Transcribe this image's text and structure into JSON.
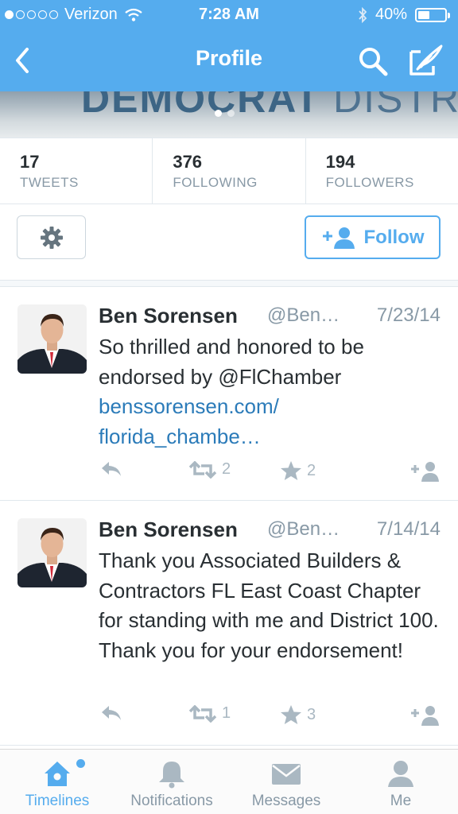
{
  "status_bar": {
    "carrier": "Verizon",
    "time": "7:28 AM",
    "battery": "40%"
  },
  "nav": {
    "title": "Profile"
  },
  "banner": {
    "text_bold": "DEMOCRAT",
    "text_thin": " DISTR"
  },
  "stats": [
    {
      "value": "17",
      "label": "TWEETS"
    },
    {
      "value": "376",
      "label": "FOLLOWING"
    },
    {
      "value": "194",
      "label": "FOLLOWERS"
    }
  ],
  "actions": {
    "follow_label": "Follow"
  },
  "tweets": [
    {
      "name": "Ben Sorensen",
      "handle": "@Ben…",
      "date": "7/23/14",
      "text_line1": "So thrilled and honored to be",
      "text_line2": "endorsed by @FlChamber",
      "link_line1": "benssorensen.com/",
      "link_line2": "florida_chambe…",
      "retweets": "2",
      "favorites": "2"
    },
    {
      "name": "Ben Sorensen",
      "handle": "@Ben…",
      "date": "7/14/14",
      "text": "Thank you Associated Builders & Contractors FL East Coast Chapter for standing with me and District 100. Thank you for your endorsement!",
      "retweets": "1",
      "favorites": "3"
    }
  ],
  "tabbar": [
    {
      "label": "Timelines",
      "icon": "home-icon",
      "active": true
    },
    {
      "label": "Notifications",
      "icon": "bell-icon",
      "active": false
    },
    {
      "label": "Messages",
      "icon": "envelope-icon",
      "active": false
    },
    {
      "label": "Me",
      "icon": "person-icon",
      "active": false
    }
  ],
  "colors": {
    "brand_blue": "#55acee",
    "link_blue": "#2b7bb9",
    "muted_gray": "#8899a6"
  }
}
